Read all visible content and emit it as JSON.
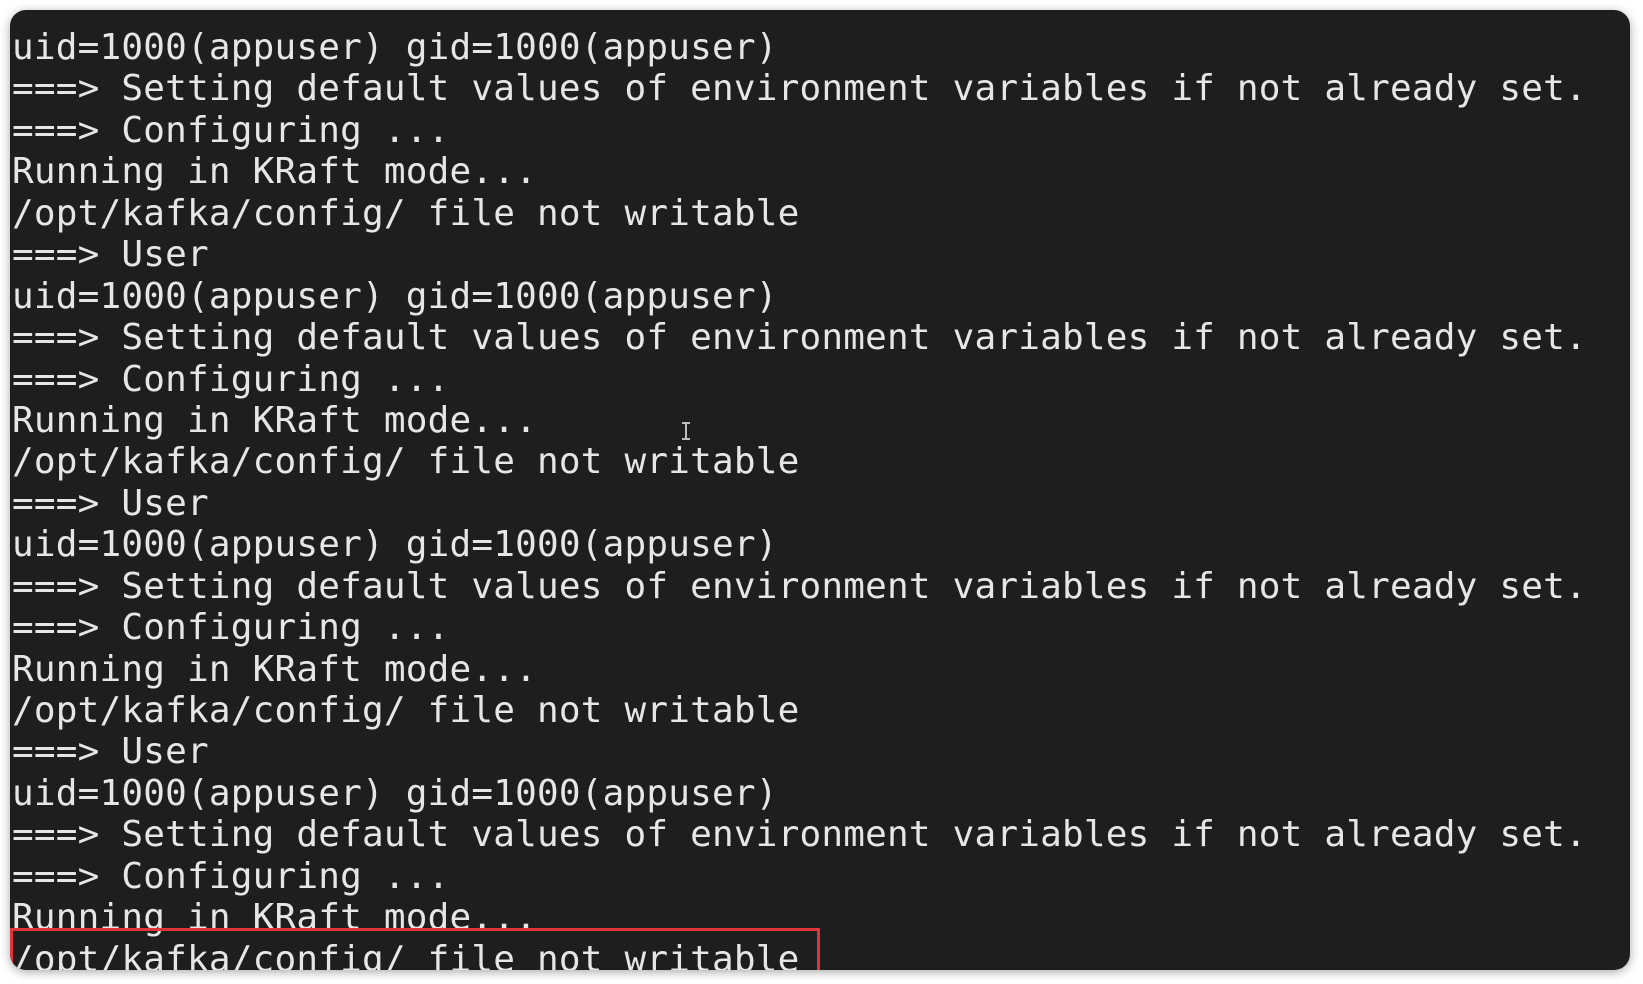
{
  "terminal": {
    "lines": [
      "uid=1000(appuser) gid=1000(appuser)",
      "===> Setting default values of environment variables if not already set.",
      "===> Configuring ...",
      "Running in KRaft mode...",
      "/opt/kafka/config/ file not writable",
      "===> User",
      "uid=1000(appuser) gid=1000(appuser)",
      "===> Setting default values of environment variables if not already set.",
      "===> Configuring ...",
      "Running in KRaft mode...",
      "/opt/kafka/config/ file not writable",
      "===> User",
      "uid=1000(appuser) gid=1000(appuser)",
      "===> Setting default values of environment variables if not already set.",
      "===> Configuring ...",
      "Running in KRaft mode...",
      "/opt/kafka/config/ file not writable",
      "===> User",
      "uid=1000(appuser) gid=1000(appuser)",
      "===> Setting default values of environment variables if not already set.",
      "===> Configuring ...",
      "Running in KRaft mode...",
      "/opt/kafka/config/ file not writable"
    ],
    "highlight_color": "#e0333a",
    "background_color": "#1e1e1e",
    "text_color": "#e6e6e6"
  }
}
